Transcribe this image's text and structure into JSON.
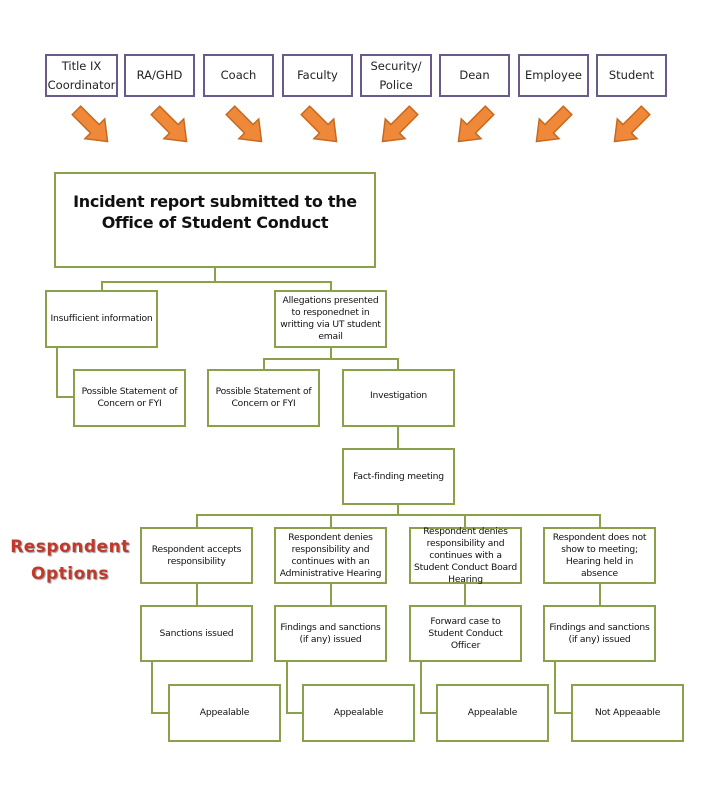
{
  "sources": [
    {
      "label": "Title IX Coordinator",
      "arrow": "down-right"
    },
    {
      "label": "RA/GHD",
      "arrow": "down-right"
    },
    {
      "label": "Coach",
      "arrow": "down-right"
    },
    {
      "label": "Faculty",
      "arrow": "down-right"
    },
    {
      "label": "Security/ Police",
      "arrow": "down-left"
    },
    {
      "label": "Dean",
      "arrow": "down-left"
    },
    {
      "label": "Employee",
      "arrow": "down-left"
    },
    {
      "label": "Student",
      "arrow": "down-left"
    }
  ],
  "colors": {
    "source_border": "#6a5a8c",
    "node_border": "#8aa04a",
    "arrow_fill": "#f0883a",
    "arrow_stroke": "#c56a20",
    "label_red": "#c0392b"
  },
  "root": "Incident report submitted to the Office of Student Conduct",
  "level1": {
    "insufficient": "Insufficient information",
    "allegations": "Allegations presented to responednet in writting via UT student email"
  },
  "level2": {
    "possible_left": "Possible Statement of Concern or FYI",
    "possible_mid": "Possible Statement of Concern or FYI",
    "investigation": "Investigation"
  },
  "fact_finding": "Fact-finding meeting",
  "side_label": {
    "line1": "Respondent",
    "line2": "Options"
  },
  "options": [
    {
      "option": "Respondent accepts responsibility",
      "outcome": "Sanctions issued",
      "appeal": "Appealable"
    },
    {
      "option": "Respondent denies responsibility and continues with an Administrative Hearing",
      "outcome": "Findings and sanctions (if any) issued",
      "appeal": "Appealable"
    },
    {
      "option": "Respondent denies responsibility and continues with a Student Conduct Board Hearing",
      "outcome": "Forward case to Student Conduct Officer",
      "appeal": "Appealable"
    },
    {
      "option": "Respondent does not show to meeting; Hearing held in absence",
      "outcome": "Findings and sanctions (if any) issued",
      "appeal": "Not Appeaable"
    }
  ]
}
